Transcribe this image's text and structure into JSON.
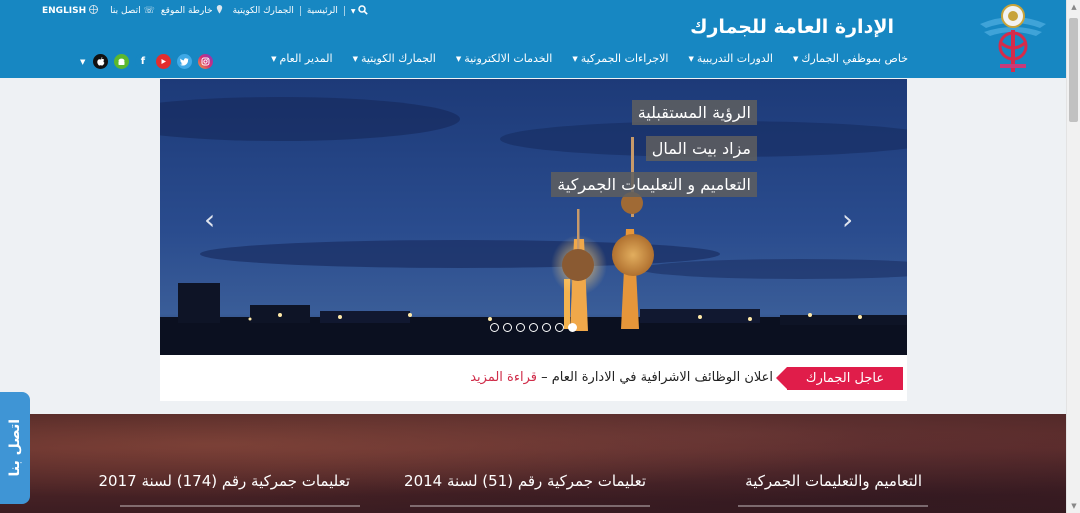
{
  "header": {
    "site_title": "الإدارة العامة للجمارك",
    "topbar": {
      "english": "ENGLISH",
      "contact": "اتصل بنا",
      "sitemap": "خارطة الموقع",
      "kuwaiti_customs": "الجمارك الكويتية",
      "home": "الرئيسية"
    },
    "nav": [
      {
        "label": "المدير العام"
      },
      {
        "label": "الجمارك الكويتية"
      },
      {
        "label": "الخدمات الالكترونية"
      },
      {
        "label": "الاجراءات الجمركية"
      },
      {
        "label": "الدورات التدريبية"
      },
      {
        "label": "خاص بموظفي الجمارك"
      }
    ],
    "colors": {
      "header_bg": "#1787c2",
      "accent_red": "#e01d4a"
    },
    "social_icons": [
      "instagram-icon",
      "twitter-icon",
      "youtube-icon",
      "facebook-icon",
      "android-icon",
      "apple-icon"
    ]
  },
  "slider": {
    "captions": [
      "الرؤية المستقبلية",
      "مزاد بيت المال",
      "التعاميم و التعليمات الجمركية"
    ],
    "prev": "‹",
    "next": "›",
    "slide_count": 7,
    "active_slide": 7
  },
  "ticker": {
    "badge": "عاجل الجمارك",
    "news": "اعلان الوظائف الاشرافية في الادارة العام",
    "dash": " – ",
    "more": "قراءة المزيد"
  },
  "cards": [
    {
      "title": "التعاميم والتعليمات الجمركية"
    },
    {
      "title": "تعليمات جمركية رقم (51) لسنة 2014"
    },
    {
      "title": "تعليمات جمركية رقم (174) لسنة 2017"
    }
  ],
  "contact_tab": "اتصل بنا"
}
